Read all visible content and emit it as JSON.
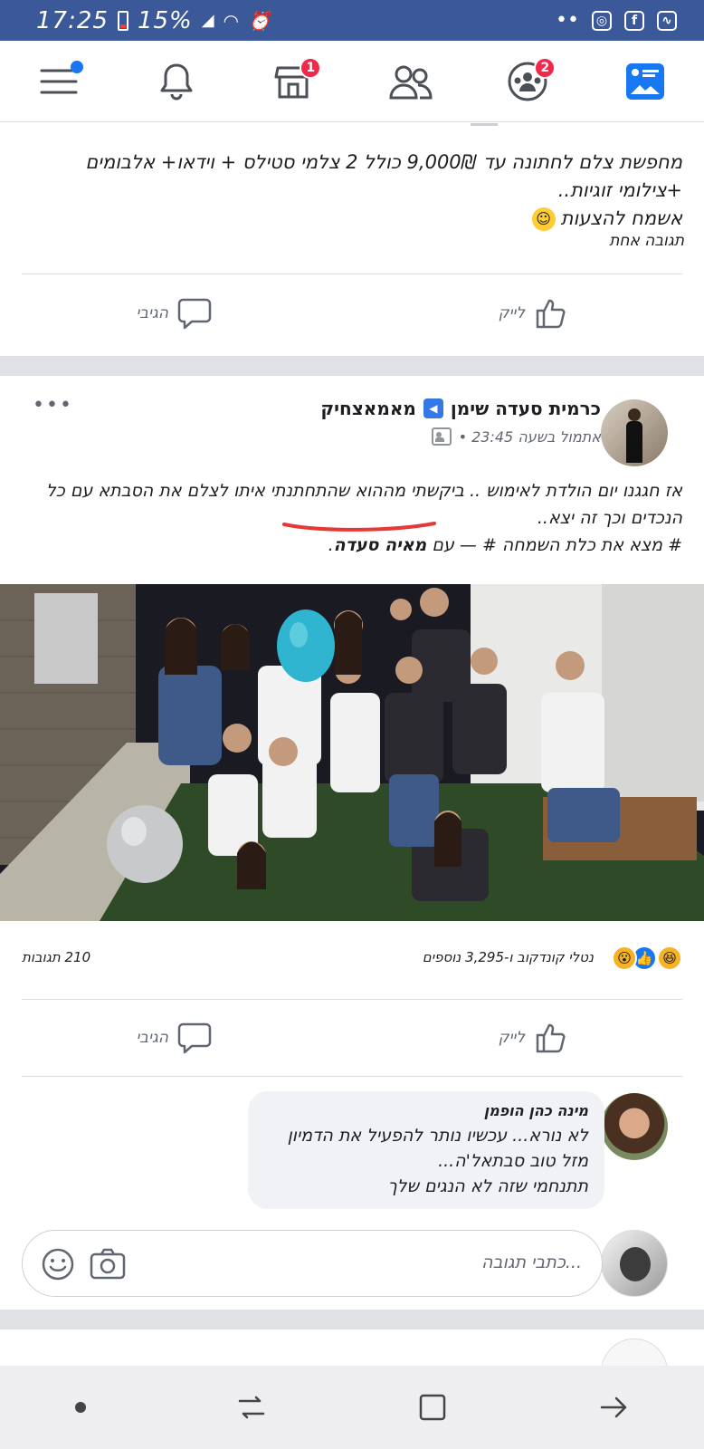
{
  "status_bar": {
    "time": "17:25",
    "battery": "15%",
    "icons": [
      "battery-icon",
      "signal-icon",
      "wifi-icon",
      "alarm-icon",
      "more-dots-icon",
      "instagram-icon",
      "facebook-icon",
      "activity-icon"
    ]
  },
  "top_nav": {
    "items": [
      {
        "name": "menu",
        "icon": "hamburger-menu-icon",
        "indicator": true
      },
      {
        "name": "notifications",
        "icon": "bell-icon"
      },
      {
        "name": "marketplace",
        "icon": "shop-icon",
        "badge": "1"
      },
      {
        "name": "friends",
        "icon": "friends-icon"
      },
      {
        "name": "groups",
        "icon": "groups-icon",
        "badge": "2"
      },
      {
        "name": "news-feed",
        "icon": "news-feed-icon",
        "active": true
      }
    ]
  },
  "card1": {
    "text_line1": "מחפשת צלם לחתונה עד 9,000₪ כולל 2 צלמי סטילס + וידאו+ אלבומים +צילומי זוגיות..",
    "text_line2": "אשמח להצעות",
    "replies": "תגובה אחת",
    "like_label": "לייק",
    "comment_label": "הגיבי"
  },
  "post": {
    "page_name": "מאמאצחיק",
    "author": "כרמית סעדה שימן",
    "time": "אתמול בשעה 23:45 •",
    "body_line1": "אז חגגנו יום הולדת לאימוש .. ביקשתי מההוא שהתחתנתי איתו לצלם את הסבתא עם כל",
    "body_line2": "הנכדים וכך זה יצא..",
    "body_line3_tag": "# מצא את כלת השמחה #",
    "body_line3_with": "— עם",
    "body_line3_person": "מאיה סעדה",
    "reactions_text": "נטלי קונדקוב ו-3,295 נוספים",
    "comments_count": "210 תגובות",
    "like_label": "לייק",
    "comment_label": "הגיבי",
    "comment": {
      "name": "מינה כהן הופמן",
      "line1": "לא נורא... עכשיו נותר להפעיל את הדמיון",
      "line2": "מזל טוב סבתאל'ה...",
      "line3": "תתנחמי שזה לא הנגים שלך"
    },
    "write_placeholder": "כתבי תגובה...",
    "colors": {
      "accent": "#3b5998",
      "like_blue": "#1877f2",
      "underline": "#e53935"
    }
  },
  "bottom_nav": {
    "icons": [
      "dot-icon",
      "recent-apps-icon",
      "home-button-icon",
      "back-icon"
    ]
  }
}
